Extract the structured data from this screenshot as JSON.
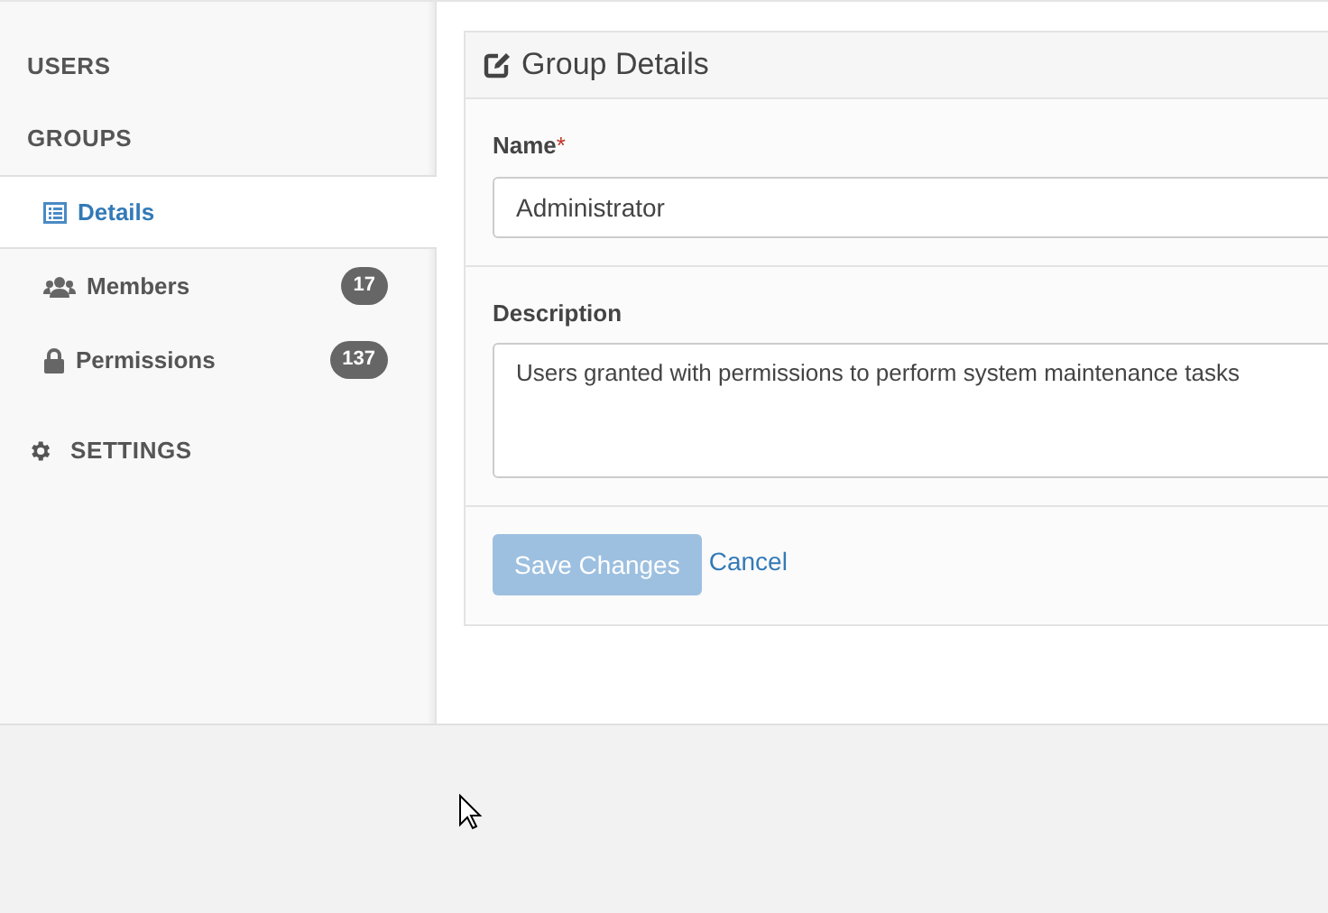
{
  "sidebar": {
    "items": [
      {
        "kind": "section",
        "label": "USERS"
      },
      {
        "kind": "section",
        "label": "GROUPS",
        "children": [
          {
            "label": "Details",
            "selected": true
          },
          {
            "label": "Members",
            "badge": "17",
            "selected": false
          },
          {
            "label": "Permissions",
            "badge": "137",
            "selected": false
          }
        ]
      },
      {
        "kind": "section-icon",
        "label": "SETTINGS"
      }
    ]
  },
  "panel": {
    "title": "Group Details",
    "fields": [
      {
        "kind": "input",
        "label": "Name",
        "required_mark": "*",
        "value": "Administrator"
      },
      {
        "kind": "textarea",
        "label": "Description",
        "value": "Users granted with permissions to perform system maintenance tasks"
      }
    ],
    "save_button": {
      "label": "Save Changes",
      "disabled": true
    },
    "cancel_link": "Cancel"
  }
}
